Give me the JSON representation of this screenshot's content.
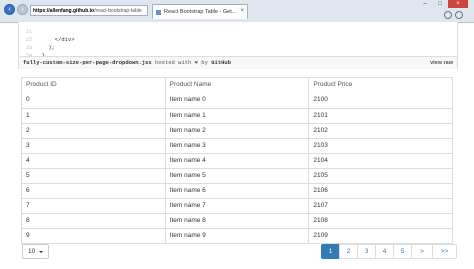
{
  "browser": {
    "address_domain": "https://allenfang.github.io",
    "address_path": "/react-bootstrap-table",
    "tab_title": "React Bootstrap Table - Get..."
  },
  "gist": {
    "lines": [
      {
        "num": "21",
        "code": "      </div>"
      },
      {
        "num": "22",
        "code": "    );"
      },
      {
        "num": "23",
        "code": "  }"
      },
      {
        "num": "24",
        "code": "}"
      }
    ],
    "filename": "fully-custom-size-per-page-dropdown.jsx",
    "hosted_text": "hosted with",
    "heart": "❤",
    "by_text": "by",
    "github": "GitHub",
    "view_raw": "view raw"
  },
  "table": {
    "headers": [
      "Product ID",
      "Product Name",
      "Product Price"
    ],
    "rows": [
      [
        "0",
        "Item name 0",
        "2100"
      ],
      [
        "1",
        "Item name 1",
        "2101"
      ],
      [
        "2",
        "Item name 2",
        "2102"
      ],
      [
        "3",
        "Item name 3",
        "2103"
      ],
      [
        "4",
        "Item name 4",
        "2104"
      ],
      [
        "5",
        "Item name 5",
        "2105"
      ],
      [
        "6",
        "Item name 6",
        "2106"
      ],
      [
        "7",
        "Item name 7",
        "2107"
      ],
      [
        "8",
        "Item name 8",
        "2108"
      ],
      [
        "9",
        "Item name 9",
        "2109"
      ]
    ]
  },
  "size_per_page": {
    "value": "10"
  },
  "pagination": {
    "pages": [
      "1",
      "2",
      "3",
      "4",
      "5"
    ],
    "next": ">",
    "last": ">>",
    "active_index": 0
  },
  "colors": {
    "accent": "#337ab7"
  }
}
